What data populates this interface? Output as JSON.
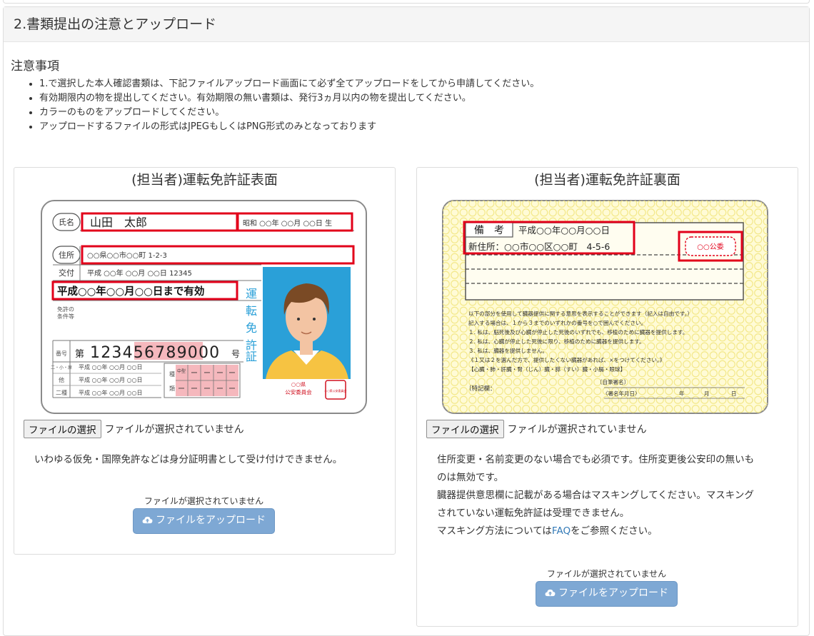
{
  "section": {
    "title": "2.書類提出の注意とアップロード"
  },
  "notes": {
    "title": "注意事項",
    "items": [
      "1.で選択した本人確認書類は、下記ファイルアップロード画面にて必ず全てアップロードをしてから申請してください。",
      "有効期限内の物を提出してください。有効期限の無い書類は、発行3ヵ月以内の物を提出してください。",
      "カラーのものをアップロードしてください。",
      "アップロードするファイルの形式はJPEGもしくはPNG形式のみとなっております"
    ]
  },
  "front": {
    "title": "(担当者)運転免許証表面",
    "file_button": "ファイルの選択",
    "file_status": "ファイルが選択されていません",
    "description": "いわゆる仮免・国際免許などは身分証明書として受け付けできません。",
    "upload_status": "ファイルが選択されていません",
    "upload_button": "ファイルをアップロード",
    "card": {
      "name_label": "氏名",
      "name": "山田　太郎",
      "birth": "昭和 ○○年 ○○月 ○○日 生",
      "address_label": "住所",
      "address": "○○県○○市○○町 1-2-3",
      "issue_label": "交付",
      "issue": "平成 ○○年 ○○月 ○○日 12345",
      "expiry": "平成○○年○○月○○日まで有効",
      "conditions_label_1": "免許の",
      "conditions_label_2": "条件等",
      "license_chars": [
        "運",
        "転",
        "免",
        "許",
        "証"
      ],
      "number_label": "番号",
      "number_prefix": "第",
      "number": "123456789000",
      "number_suffix": "号",
      "history_labels": [
        "二・小・原",
        "他",
        "二種"
      ],
      "history_date": "平成 ○○年 ○○月 ○○日",
      "type_labels": [
        "種",
        "類"
      ],
      "type_cells": [
        "中型",
        "ー"
      ],
      "authority_1": "○○県",
      "authority_2": "公安委員会",
      "seal": "○○県公安委員会"
    }
  },
  "back": {
    "title": "(担当者)運転免許証裏面",
    "file_button": "ファイルの選択",
    "file_status": "ファイルが選択されていません",
    "desc_line1": "住所変更・名前変更のない場合でも必須です。住所変更後公安印の無いも",
    "desc_line2": "のは無効です。",
    "desc_line3": "臓器提供意思欄に記載がある場合はマスキングしてください。マスキング",
    "desc_line4": "されていない運転免許証は受理できません。",
    "desc_line5_pre": "マスキング方法については",
    "desc_link": "FAQ",
    "desc_line5_post": "をご参照ください。",
    "upload_status": "ファイルが選択されていません",
    "upload_button": "ファイルをアップロード",
    "card": {
      "remarks_label": "備　考",
      "remarks_date": "平成○○年○○月○○日",
      "new_address": "新住所：○○市○○区○○町　4-5-6",
      "stamp": "○○公委",
      "organ_lines": [
        "以下の部分を使用して臓器提供に関する意思を表示することができます（記入は自由です。）",
        "記入する場合は、１から３までのいずれかの番号を○で囲んでください。",
        "１. 私は、脳死後及び心臓が停止した死後のいずれでも、移植のために臓器を提供します。",
        "２. 私は、心臓が停止した死後に限り、移植のために臓器を提供します。",
        "３. 私は、臓器を提供しません。",
        "《１又は２を選んだ方で、提供したくない臓器があれば、×をつけてください。》",
        "【心臓・肺・肝臓・腎（じん）臓・膵（すい）臓・小腸・眼球】"
      ],
      "special_label": "〔特記欄：",
      "signature_label": "〔自筆署名〕",
      "signature_date": "〈署名年月日〉",
      "year": "年",
      "month": "月",
      "day": "日"
    }
  },
  "colors": {
    "highlight": "#e2001a",
    "button_primary": "#7ea8d4",
    "link": "#337ab7",
    "card_blue": "#2aa0d8",
    "card_back_yellow": "#fffbd6",
    "number_pink": "#f5b8bd"
  }
}
